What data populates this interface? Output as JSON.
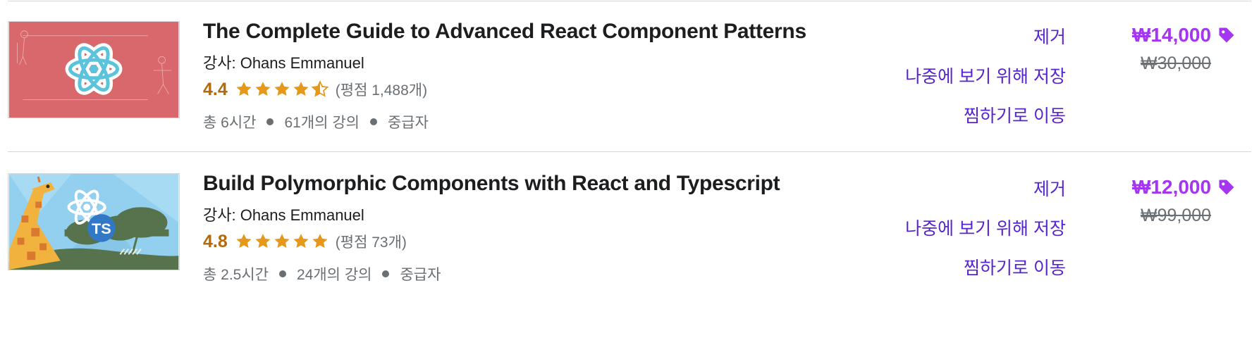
{
  "colors": {
    "accent_link": "#5624d0",
    "price": "#a435f0",
    "rating": "#b4690e",
    "star": "#e59819",
    "muted_text": "#6a6f73"
  },
  "courses": [
    {
      "thumbnail_icon": "react-atom-icon",
      "title": "The Complete Guide to Advanced React Component Patterns",
      "instructor": "강사: Ohans Emmanuel",
      "rating": "4.4",
      "rating_value": 4.4,
      "stars_shown": 4.5,
      "rating_count": "(평점 1,488개)",
      "duration": "총 6시간",
      "lectures": "61개의 강의",
      "level": "중급자",
      "actions": {
        "remove": "제거",
        "save_for_later": "나중에 보기 위해 저장",
        "move_to_wishlist": "찜하기로 이동"
      },
      "price": "₩14,000",
      "original_price": "₩30,000"
    },
    {
      "thumbnail_icon": "react-typescript-giraffe-icon",
      "title": "Build Polymorphic Components with React and Typescript",
      "instructor": "강사: Ohans Emmanuel",
      "rating": "4.8",
      "rating_value": 4.8,
      "stars_shown": 5,
      "rating_count": "(평점 73개)",
      "duration": "총 2.5시간",
      "lectures": "24개의 강의",
      "level": "중급자",
      "actions": {
        "remove": "제거",
        "save_for_later": "나중에 보기 위해 저장",
        "move_to_wishlist": "찜하기로 이동"
      },
      "price": "₩12,000",
      "original_price": "₩99,000"
    }
  ]
}
